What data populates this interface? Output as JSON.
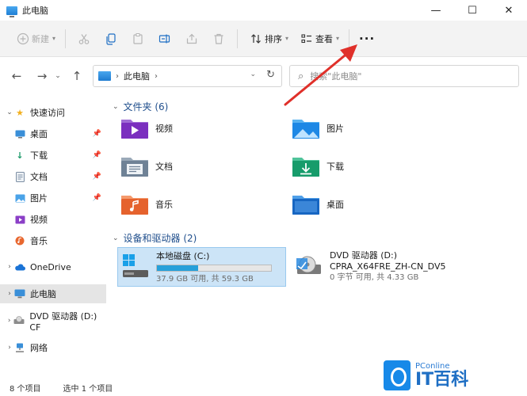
{
  "window": {
    "title": "此电脑",
    "minimize": "—",
    "maximize": "☐",
    "close": "✕"
  },
  "commandbar": {
    "new_label": "新建",
    "sort_label": "排序",
    "view_label": "查看",
    "more_label": "···"
  },
  "address": {
    "segment": "此电脑",
    "search_placeholder": "搜索\"此电脑\""
  },
  "sidebar": {
    "quick_access": "快速访问",
    "items": [
      {
        "label": "桌面"
      },
      {
        "label": "下载"
      },
      {
        "label": "文档"
      },
      {
        "label": "图片"
      },
      {
        "label": "视频"
      },
      {
        "label": "音乐"
      }
    ],
    "onedrive": "OneDrive",
    "this_pc": "此电脑",
    "dvd": "DVD 驱动器 (D:) CF",
    "network": "网络"
  },
  "folders_group": {
    "title": "文件夹 (6)",
    "items": [
      {
        "label": "视频",
        "icon": "videos-folder-icon"
      },
      {
        "label": "图片",
        "icon": "pictures-folder-icon"
      },
      {
        "label": "文档",
        "icon": "documents-folder-icon"
      },
      {
        "label": "下载",
        "icon": "downloads-folder-icon"
      },
      {
        "label": "音乐",
        "icon": "music-folder-icon"
      },
      {
        "label": "桌面",
        "icon": "desktop-folder-icon"
      }
    ]
  },
  "drives_group": {
    "title": "设备和驱动器 (2)",
    "drives": [
      {
        "name": "本地磁盘 (C:)",
        "free_text": "37.9 GB 可用, 共 59.3 GB",
        "used_fraction": 0.36
      },
      {
        "name": "DVD 驱动器 (D:)",
        "label": "CPRA_X64FRE_ZH-CN_DV5",
        "free_text": "0 字节 可用, 共 4.33 GB"
      }
    ]
  },
  "statusbar": {
    "count": "8 个项目",
    "selected": "选中 1 个项目"
  },
  "watermark": {
    "top": "PConline",
    "main": "IT百科"
  },
  "colors": {
    "accent": "#26a0da",
    "arrow": "#e0302a",
    "group_title": "#1f4e8c"
  }
}
